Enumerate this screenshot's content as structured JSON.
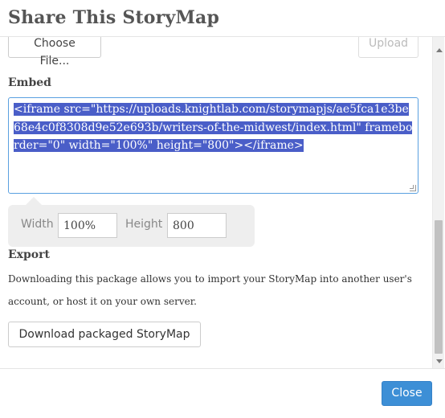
{
  "dialog": {
    "title": "Share This StoryMap"
  },
  "upload": {
    "choose_file_label": "Choose File...",
    "upload_label": "Upload"
  },
  "embed": {
    "label": "Embed",
    "code": "<iframe src=\"https://uploads.knightlab.com/storymapjs/ae5fca1e3be68e4c0f8308d9e52e693b/writers-of-the-midwest/index.html\" frameborder=\"0\" width=\"100%\" height=\"800\"></iframe>",
    "width_label": "Width",
    "width_value": "100%",
    "height_label": "Height",
    "height_value": "800"
  },
  "export": {
    "label": "Export",
    "description": "Downloading this package allows you to import your StoryMap into another user's account, or host it on your own server.",
    "download_label": "Download packaged StoryMap"
  },
  "footer": {
    "close_label": "Close"
  },
  "colors": {
    "accent": "#3d8fd6",
    "selection": "#4a5ec8",
    "panel": "#eeeeee"
  }
}
